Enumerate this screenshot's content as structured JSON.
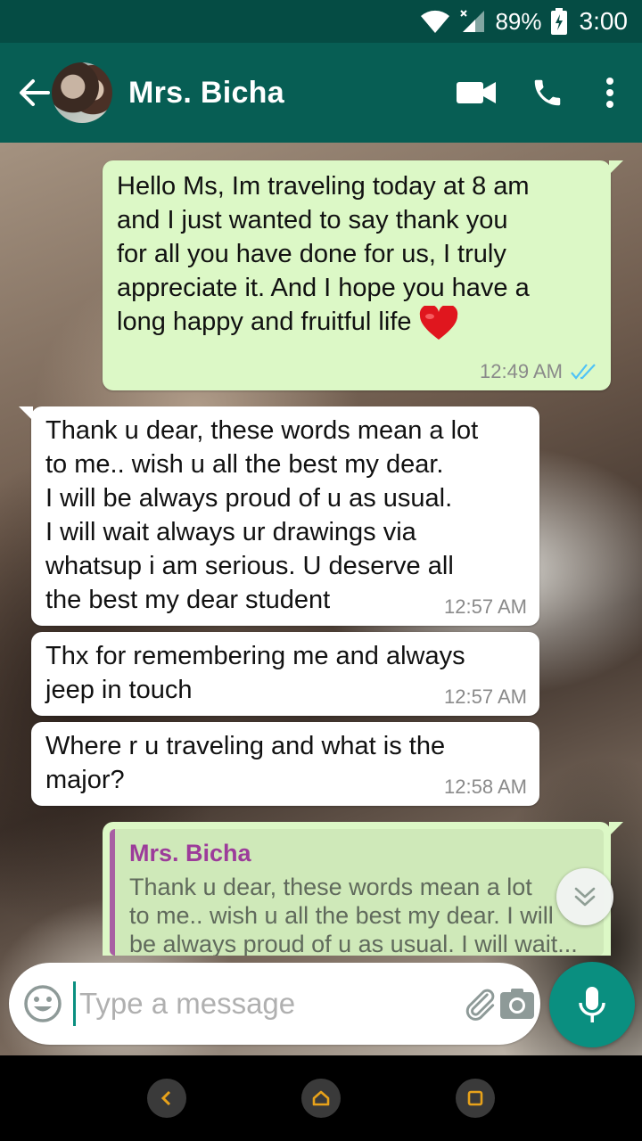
{
  "status_bar": {
    "battery": "89%",
    "time": "3:00"
  },
  "header": {
    "contact_name": "Mrs. Bicha"
  },
  "messages": [
    {
      "direction": "out",
      "text": "Hello Ms, Im traveling today at 8 am\nand I just wanted to say thank you\nfor all you have done for us, I truly\nappreciate it. And I hope you have a\nlong happy and fruitful life",
      "emoji": "red-heart",
      "time": "12:49 AM",
      "status": "read"
    },
    {
      "direction": "in",
      "text": "Thank u dear, these words mean a lot\nto me.. wish u all the best my dear.\nI will be always proud of u as usual.\nI will wait always ur drawings via\nwhatsup i am serious. U deserve all\nthe best my dear student",
      "time": "12:57 AM"
    },
    {
      "direction": "in",
      "text": "Thx for remembering me and always\njeep in touch",
      "time": "12:57 AM"
    },
    {
      "direction": "in",
      "text": "Where r u traveling and what is the\nmajor?",
      "time": "12:58 AM"
    }
  ],
  "reply_quote": {
    "name": "Mrs. Bicha",
    "text": "Thank u dear, these words mean a lot\nto me.. wish u all the best my dear. I will\nbe always proud of u as usual. I will wait..."
  },
  "composer": {
    "placeholder": "Type a message"
  },
  "colors": {
    "header": "#075e54",
    "status": "#054c44",
    "outgoing": "#dcf8c6",
    "incoming": "#ffffff",
    "accent": "#0a8f80",
    "read_ticks": "#4fc3f7",
    "quote_name": "#9c3c9a"
  },
  "icons": [
    "back-arrow-icon",
    "video-call-icon",
    "phone-icon",
    "more-vert-icon",
    "emoji-icon",
    "attach-icon",
    "camera-icon",
    "mic-icon",
    "scroll-down-icon"
  ]
}
